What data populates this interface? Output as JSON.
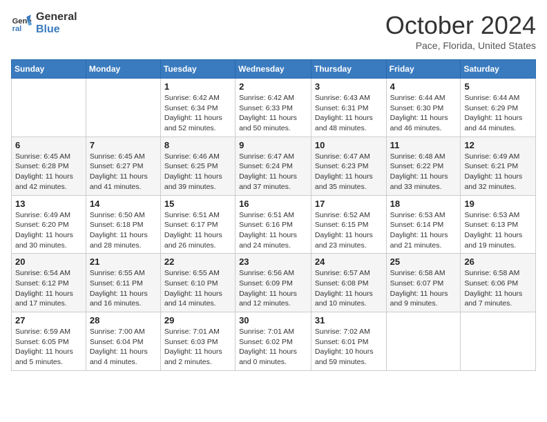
{
  "logo": {
    "line1": "General",
    "line2": "Blue"
  },
  "title": "October 2024",
  "location": "Pace, Florida, United States",
  "weekdays": [
    "Sunday",
    "Monday",
    "Tuesday",
    "Wednesday",
    "Thursday",
    "Friday",
    "Saturday"
  ],
  "weeks": [
    [
      {
        "day": "",
        "info": ""
      },
      {
        "day": "",
        "info": ""
      },
      {
        "day": "1",
        "info": "Sunrise: 6:42 AM\nSunset: 6:34 PM\nDaylight: 11 hours and 52 minutes."
      },
      {
        "day": "2",
        "info": "Sunrise: 6:42 AM\nSunset: 6:33 PM\nDaylight: 11 hours and 50 minutes."
      },
      {
        "day": "3",
        "info": "Sunrise: 6:43 AM\nSunset: 6:31 PM\nDaylight: 11 hours and 48 minutes."
      },
      {
        "day": "4",
        "info": "Sunrise: 6:44 AM\nSunset: 6:30 PM\nDaylight: 11 hours and 46 minutes."
      },
      {
        "day": "5",
        "info": "Sunrise: 6:44 AM\nSunset: 6:29 PM\nDaylight: 11 hours and 44 minutes."
      }
    ],
    [
      {
        "day": "6",
        "info": "Sunrise: 6:45 AM\nSunset: 6:28 PM\nDaylight: 11 hours and 42 minutes."
      },
      {
        "day": "7",
        "info": "Sunrise: 6:45 AM\nSunset: 6:27 PM\nDaylight: 11 hours and 41 minutes."
      },
      {
        "day": "8",
        "info": "Sunrise: 6:46 AM\nSunset: 6:25 PM\nDaylight: 11 hours and 39 minutes."
      },
      {
        "day": "9",
        "info": "Sunrise: 6:47 AM\nSunset: 6:24 PM\nDaylight: 11 hours and 37 minutes."
      },
      {
        "day": "10",
        "info": "Sunrise: 6:47 AM\nSunset: 6:23 PM\nDaylight: 11 hours and 35 minutes."
      },
      {
        "day": "11",
        "info": "Sunrise: 6:48 AM\nSunset: 6:22 PM\nDaylight: 11 hours and 33 minutes."
      },
      {
        "day": "12",
        "info": "Sunrise: 6:49 AM\nSunset: 6:21 PM\nDaylight: 11 hours and 32 minutes."
      }
    ],
    [
      {
        "day": "13",
        "info": "Sunrise: 6:49 AM\nSunset: 6:20 PM\nDaylight: 11 hours and 30 minutes."
      },
      {
        "day": "14",
        "info": "Sunrise: 6:50 AM\nSunset: 6:18 PM\nDaylight: 11 hours and 28 minutes."
      },
      {
        "day": "15",
        "info": "Sunrise: 6:51 AM\nSunset: 6:17 PM\nDaylight: 11 hours and 26 minutes."
      },
      {
        "day": "16",
        "info": "Sunrise: 6:51 AM\nSunset: 6:16 PM\nDaylight: 11 hours and 24 minutes."
      },
      {
        "day": "17",
        "info": "Sunrise: 6:52 AM\nSunset: 6:15 PM\nDaylight: 11 hours and 23 minutes."
      },
      {
        "day": "18",
        "info": "Sunrise: 6:53 AM\nSunset: 6:14 PM\nDaylight: 11 hours and 21 minutes."
      },
      {
        "day": "19",
        "info": "Sunrise: 6:53 AM\nSunset: 6:13 PM\nDaylight: 11 hours and 19 minutes."
      }
    ],
    [
      {
        "day": "20",
        "info": "Sunrise: 6:54 AM\nSunset: 6:12 PM\nDaylight: 11 hours and 17 minutes."
      },
      {
        "day": "21",
        "info": "Sunrise: 6:55 AM\nSunset: 6:11 PM\nDaylight: 11 hours and 16 minutes."
      },
      {
        "day": "22",
        "info": "Sunrise: 6:55 AM\nSunset: 6:10 PM\nDaylight: 11 hours and 14 minutes."
      },
      {
        "day": "23",
        "info": "Sunrise: 6:56 AM\nSunset: 6:09 PM\nDaylight: 11 hours and 12 minutes."
      },
      {
        "day": "24",
        "info": "Sunrise: 6:57 AM\nSunset: 6:08 PM\nDaylight: 11 hours and 10 minutes."
      },
      {
        "day": "25",
        "info": "Sunrise: 6:58 AM\nSunset: 6:07 PM\nDaylight: 11 hours and 9 minutes."
      },
      {
        "day": "26",
        "info": "Sunrise: 6:58 AM\nSunset: 6:06 PM\nDaylight: 11 hours and 7 minutes."
      }
    ],
    [
      {
        "day": "27",
        "info": "Sunrise: 6:59 AM\nSunset: 6:05 PM\nDaylight: 11 hours and 5 minutes."
      },
      {
        "day": "28",
        "info": "Sunrise: 7:00 AM\nSunset: 6:04 PM\nDaylight: 11 hours and 4 minutes."
      },
      {
        "day": "29",
        "info": "Sunrise: 7:01 AM\nSunset: 6:03 PM\nDaylight: 11 hours and 2 minutes."
      },
      {
        "day": "30",
        "info": "Sunrise: 7:01 AM\nSunset: 6:02 PM\nDaylight: 11 hours and 0 minutes."
      },
      {
        "day": "31",
        "info": "Sunrise: 7:02 AM\nSunset: 6:01 PM\nDaylight: 10 hours and 59 minutes."
      },
      {
        "day": "",
        "info": ""
      },
      {
        "day": "",
        "info": ""
      }
    ]
  ]
}
